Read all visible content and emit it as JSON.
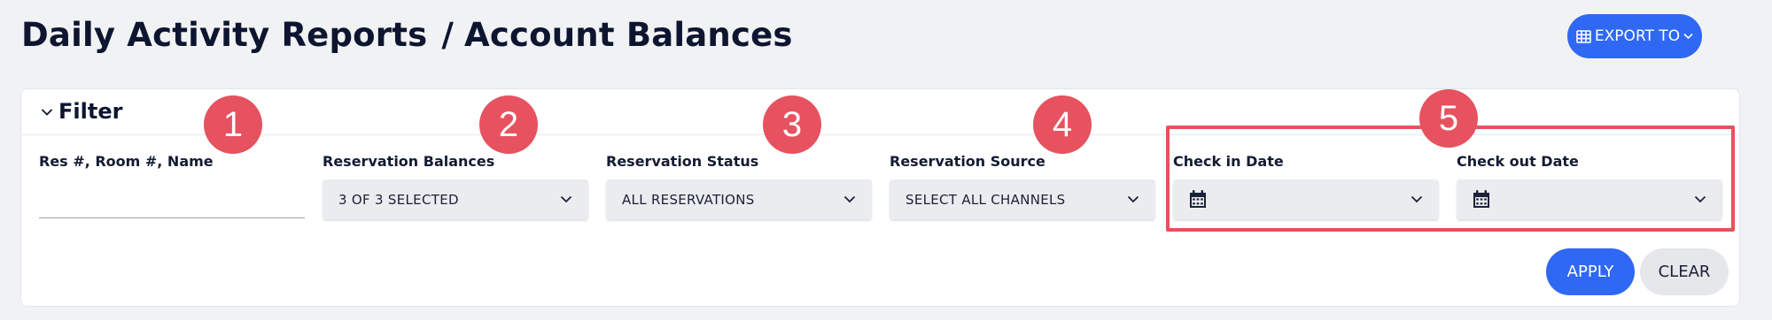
{
  "header": {
    "breadcrumb_parent": "Daily Activity Reports",
    "breadcrumb_separator": "/",
    "breadcrumb_current": "Account Balances",
    "export_label": "EXPORT TO",
    "export_icon": "table-icon"
  },
  "filter": {
    "title": "Filter",
    "fields": {
      "search": {
        "label": "Res #, Room #, Name",
        "value": "",
        "placeholder": ""
      },
      "balances": {
        "label": "Reservation Balances",
        "value": "3 OF 3 SELECTED"
      },
      "status": {
        "label": "Reservation Status",
        "value": "ALL RESERVATIONS"
      },
      "source": {
        "label": "Reservation Source",
        "value": "SELECT ALL CHANNELS"
      },
      "check_in": {
        "label": "Check in Date",
        "value": ""
      },
      "check_out": {
        "label": "Check out Date",
        "value": ""
      }
    },
    "apply_label": "APPLY",
    "clear_label": "CLEAR"
  },
  "callouts": [
    "1",
    "2",
    "3",
    "4",
    "5"
  ],
  "colors": {
    "accent": "#2f68f2",
    "annotation": "#e6525f",
    "background": "#f1f2f4"
  }
}
